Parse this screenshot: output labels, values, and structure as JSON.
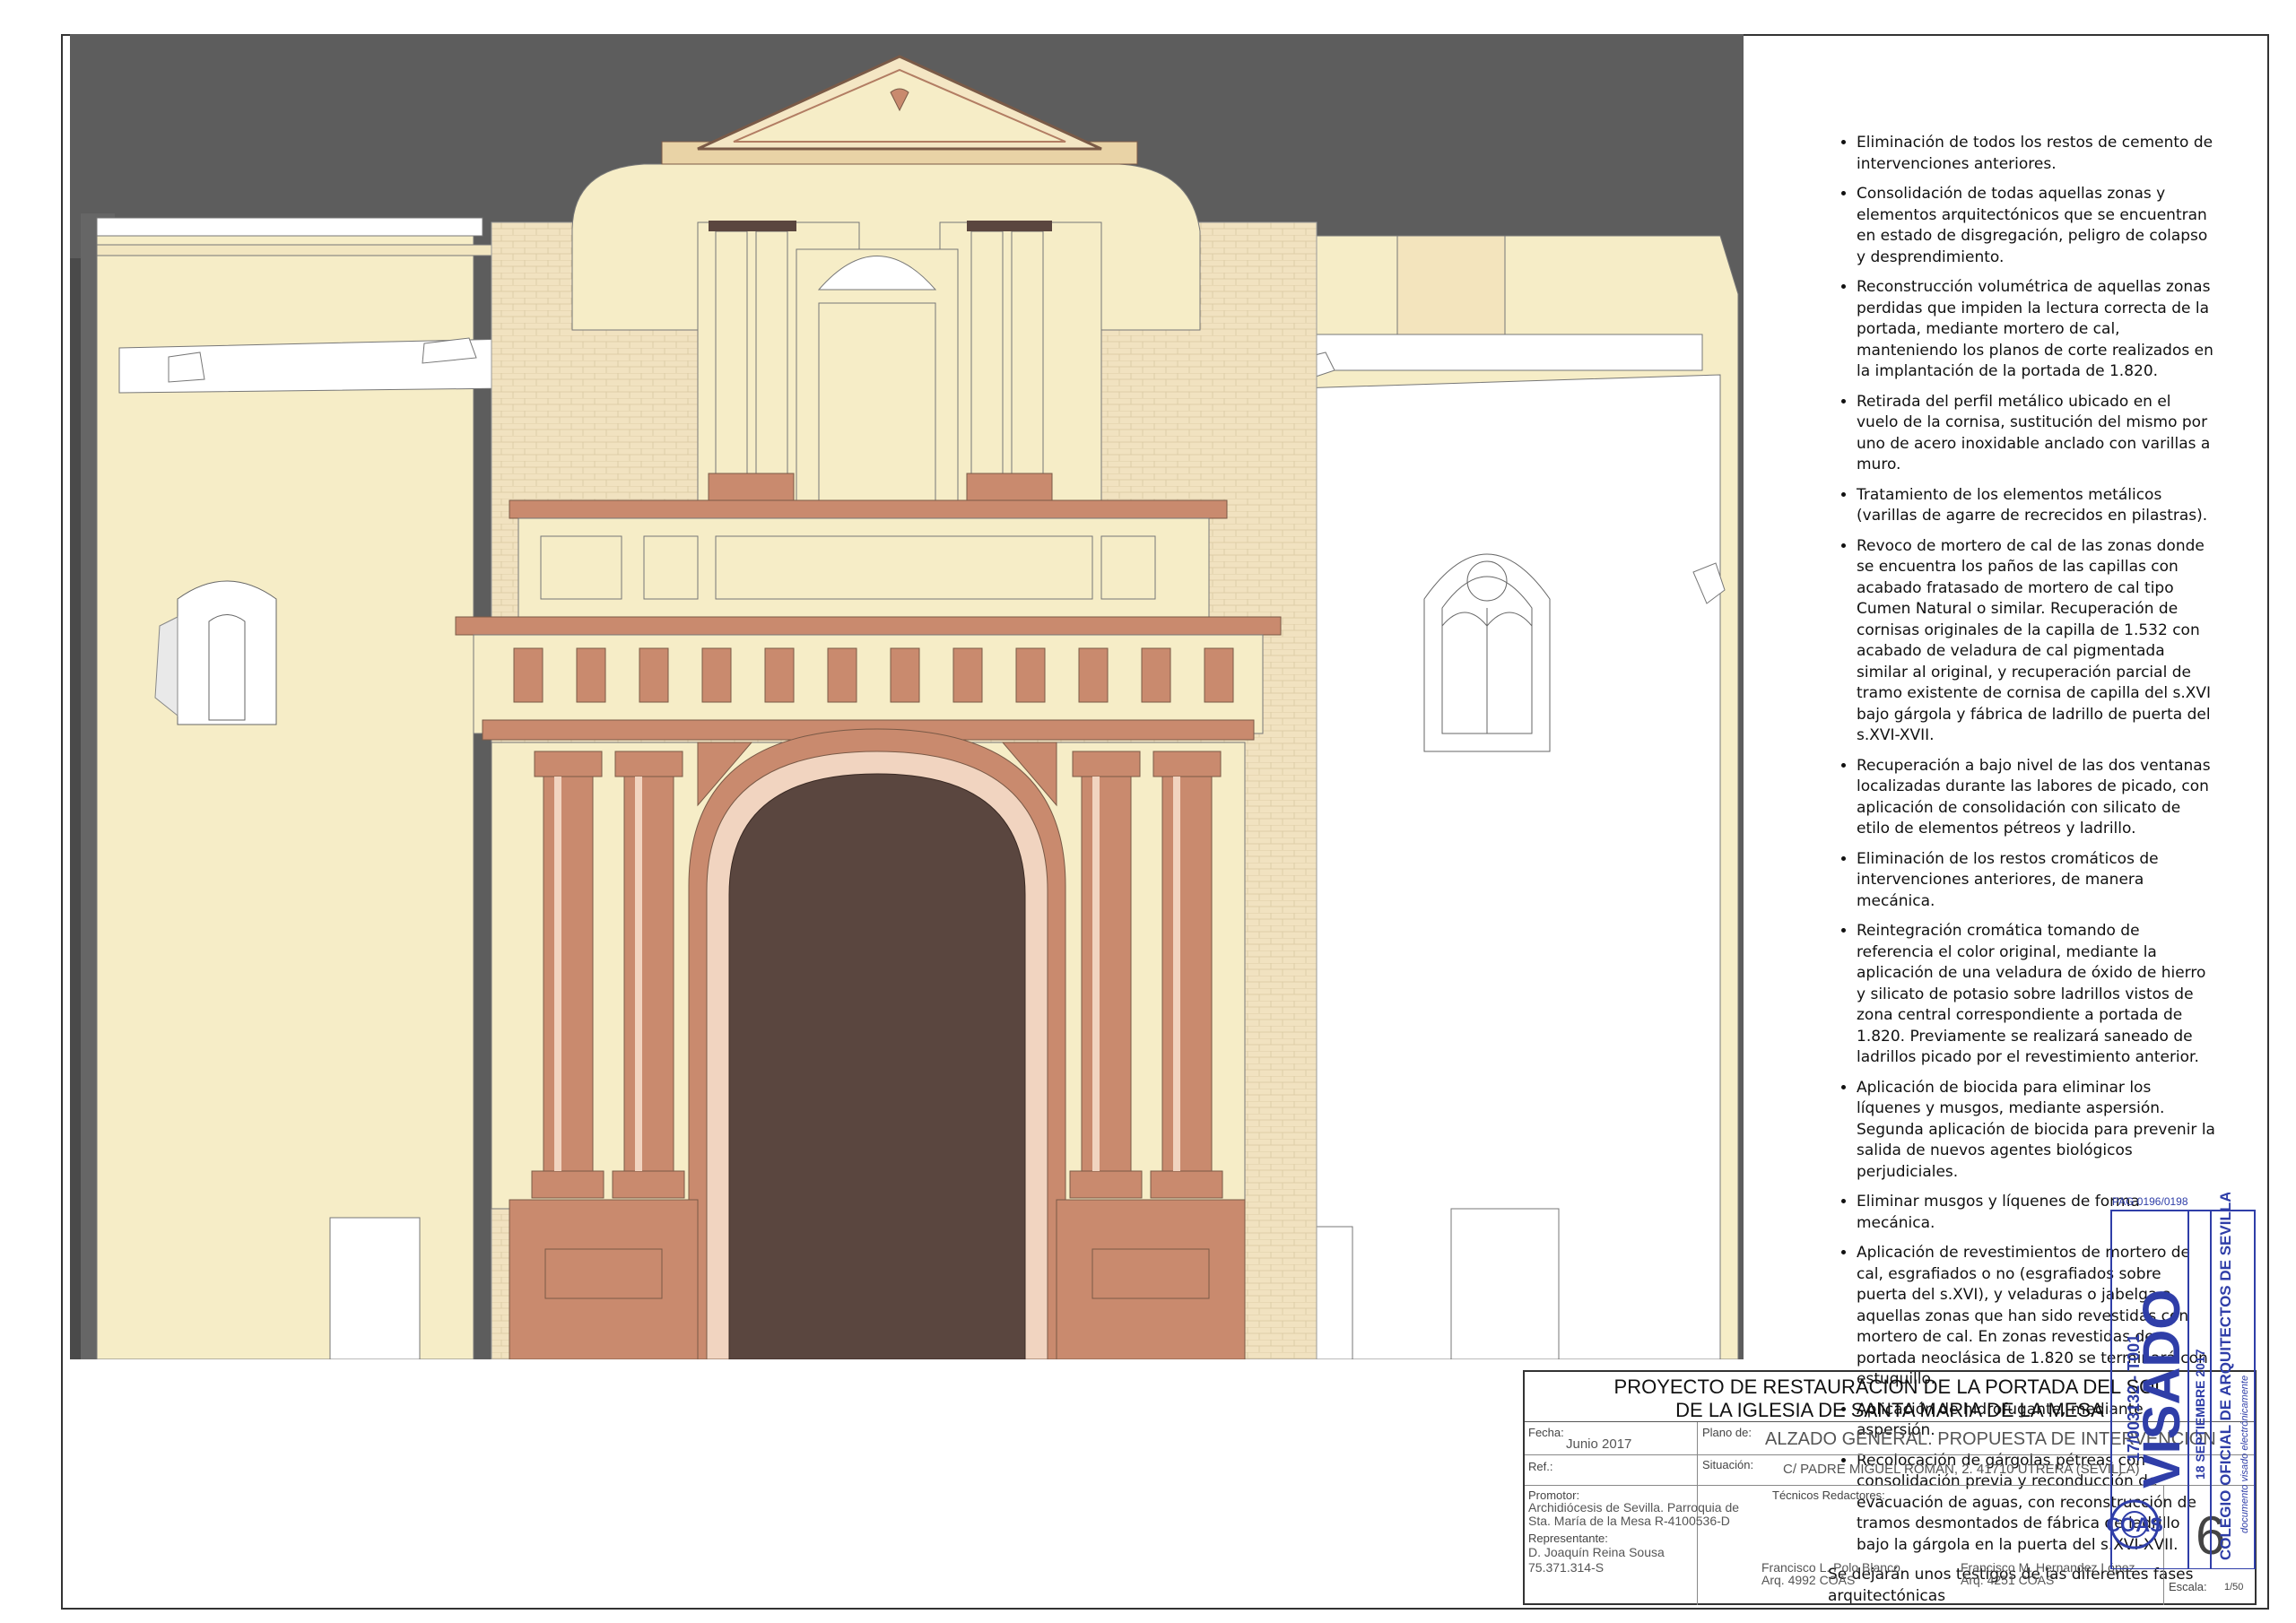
{
  "notes": {
    "items": [
      "Eliminación de todos los restos de cemento de intervenciones anteriores.",
      "Consolidación de todas aquellas zonas y elementos arquitectónicos que se encuentran en estado de disgregación, peligro de colapso y desprendimiento.",
      "Reconstrucción volumétrica de aquellas zonas perdidas que impiden la lectura correcta de la  portada, mediante mortero de cal, manteniendo los planos de corte realizados en la implantación de la portada de 1.820.",
      "Retirada del perfil metálico ubicado en el vuelo de la cornisa, sustitución del mismo por uno de acero inoxidable anclado con varillas a muro.",
      "Tratamiento de los elementos metálicos (varillas de agarre de recrecidos en pilastras).",
      "Revoco de mortero de cal de las zonas donde se encuentra los paños de las capillas con acabado fratasado de mortero de cal tipo Cumen Natural o similar. Recuperación de cornisas originales de la capilla de 1.532 con acabado de veladura de cal pigmentada similar al original, y recuperación parcial de tramo existente de cornisa de capilla del s.XVI bajo gárgola y fábrica de ladrillo de puerta del s.XVI-XVII.",
      "Recuperación a bajo nivel de las dos ventanas localizadas durante las labores de picado, con aplicación de consolidación con silicato de etilo de elementos pétreos y ladrillo.",
      "Eliminación de los restos cromáticos de intervenciones anteriores, de manera mecánica.",
      "Reintegración cromática tomando de referencia el color original, mediante la aplicación de una veladura de óxido de hierro y silicato de potasio sobre ladrillos vistos de zona central correspondiente a portada de 1.820. Previamente se realizará saneado de ladrillos picado por el revestimiento anterior.",
      "Aplicación de biocida para eliminar los líquenes y musgos, mediante aspersión. Segunda aplicación de biocida para prevenir la salida de nuevos agentes biológicos perjudiciales.",
      "Eliminar musgos y líquenes de forma mecánica.",
      "Aplicación de revestimientos de mortero de cal, esgrafiados o no (esgrafiados sobre puerta del s.XVI), y veladuras o jabelga a aquellas zonas que han sido revestidas con mortero de cal. En zonas revestidas de portada neoclásica de 1.820 se terminará con estuquillo.",
      "Aplicación de hidrofugante, mediante aspersión.",
      "Recolocación de gárgolas pétreas con consolidación previa y reconducción de evacuación de aguas, con reconstrucción de tramos desmontados de fábrica de ladrillo bajo la  gárgola en la puerta del s.XVI-XVII."
    ],
    "closing": "Se dejarán unos testigos de las diferentes fases arquitectónicas"
  },
  "title_block": {
    "title_line1": "PROYECTO DE RESTAURACION DE LA PORTADA DEL SOL",
    "title_line2": "DE LA IGLESIA DE SANTA MARIA DE LA MESA",
    "fecha_label": "Fecha:",
    "fecha_value": "Junio 2017",
    "plano_label": "Plano de:",
    "plano_value": "ALZADO GENERAL. PROPUESTA DE INTERVENCION",
    "ref_label": "Ref.:",
    "situacion_label": "Situación:",
    "situacion_value": "C/ PADRE MIGUEL ROMAN, 2.  41710 UTRERA (SEVILLA)",
    "promotor_label": "Promotor:",
    "promotor_line1": "Archidiócesis de Sevilla. Parroquia de",
    "promotor_line2": "Sta. María de la Mesa  R-4100536-D",
    "representante_label": "Representante:",
    "representante_line1": "D. Joaquín Reina Sousa",
    "representante_line2": "75.371.314-S",
    "tecnicos_label": "Técnicos Redactores:",
    "tecnico1_name": "Francisco L. Polo Blanco",
    "tecnico1_id": "Arq. 4992 COAS",
    "tecnico2_name": "Francisco M. Hernandez López",
    "tecnico2_id": "Arq. 4251 COAS",
    "sheet_number": "6",
    "escala_label": "Escala:",
    "escala_value": "1/50"
  },
  "stamp": {
    "visado": "VISADO",
    "pag": "PAG 0196/0198",
    "number": "17/003132 - T001",
    "date": "18 SEPTIEMBRE 2017",
    "colegio": "COLEGIO OFICIAL DE ARQUITECTOS DE SEVILLA",
    "electronic": "documento visado electrónicamente",
    "coas": "COAS"
  },
  "colors": {
    "background_grey": "#5d5d5d",
    "wall_cream": "#f6edc7",
    "brick": "#f2e3c2",
    "terracotta": "#c98a6e",
    "door": "#5a463f",
    "stamp_blue": "#2f3ea8"
  }
}
